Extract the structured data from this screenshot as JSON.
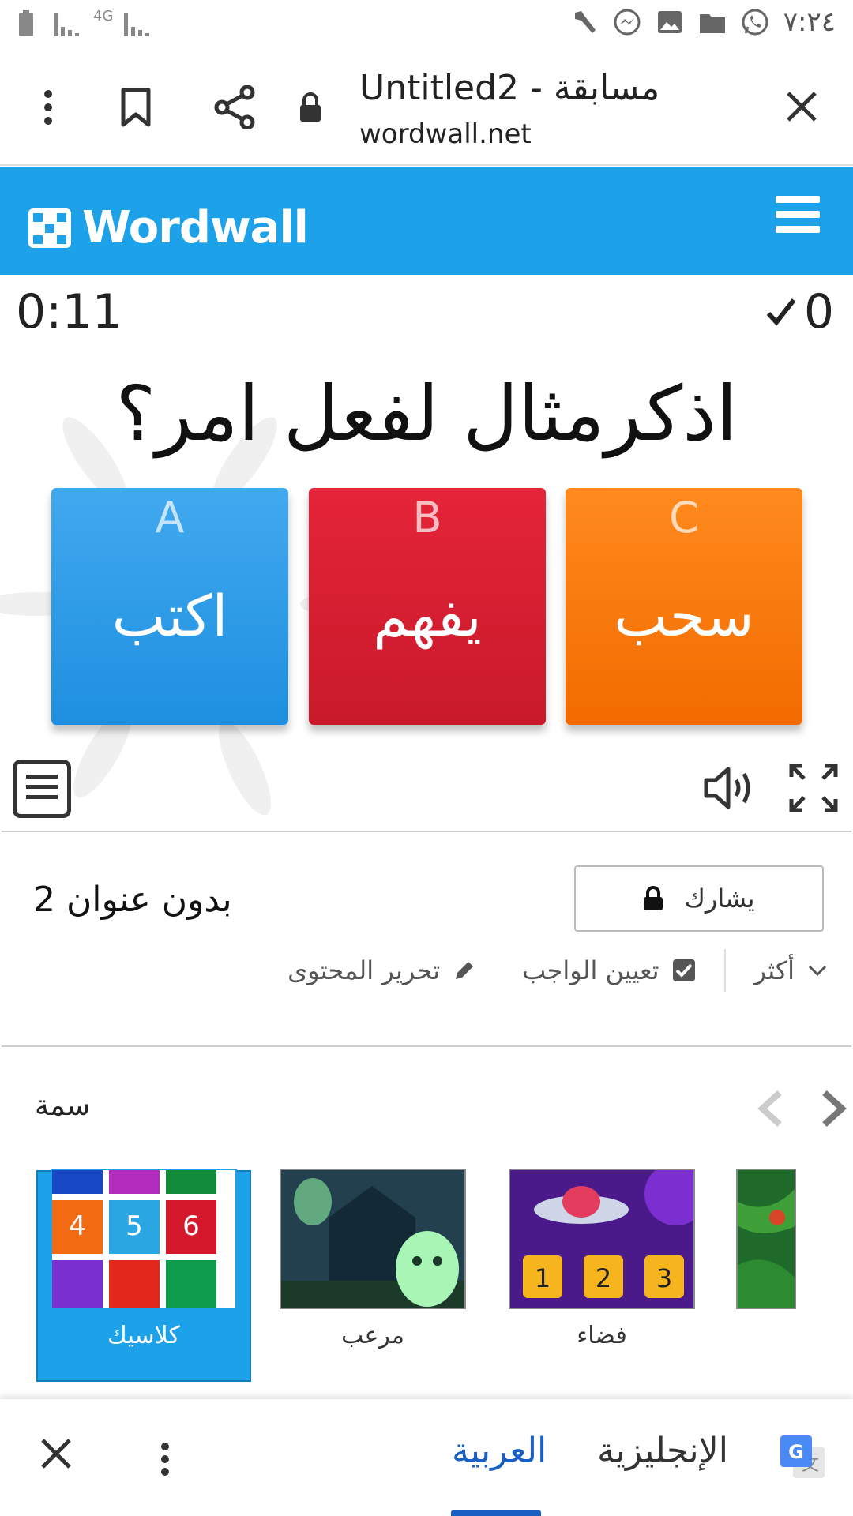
{
  "status_bar": {
    "signal_left": "4G",
    "time": "٧:٢٤"
  },
  "browser": {
    "page_title": "Untitled2 - مسابقة",
    "url": "wordwall.net"
  },
  "site": {
    "brand": "Wordwall"
  },
  "game": {
    "timer": "0:11",
    "score": "0",
    "question": "اذكرمثال لفعل امر؟",
    "answers": [
      {
        "letter": "A",
        "text": "اكتب",
        "color": "#2b9ae9"
      },
      {
        "letter": "B",
        "text": "يفهم",
        "color": "#dc1f32"
      },
      {
        "letter": "C",
        "text": "سحب",
        "color": "#fb7a10"
      }
    ]
  },
  "activity": {
    "title": "بدون عنوان 2",
    "share_label": "يشارك",
    "more_label": "أكثر",
    "assign_label": "تعيين الواجب",
    "edit_label": "تحرير المحتوى"
  },
  "theme": {
    "label": "سمة",
    "items": [
      {
        "name": "كلاسيك",
        "selected": true
      },
      {
        "name": "مرعب",
        "selected": false
      },
      {
        "name": "فضاء",
        "selected": false
      }
    ]
  },
  "translate_bar": {
    "target_language": "العربية",
    "source_language": "الإنجليزية"
  },
  "colors": {
    "brand_blue": "#1da1e8",
    "translate_blue": "#1a5fc4"
  }
}
